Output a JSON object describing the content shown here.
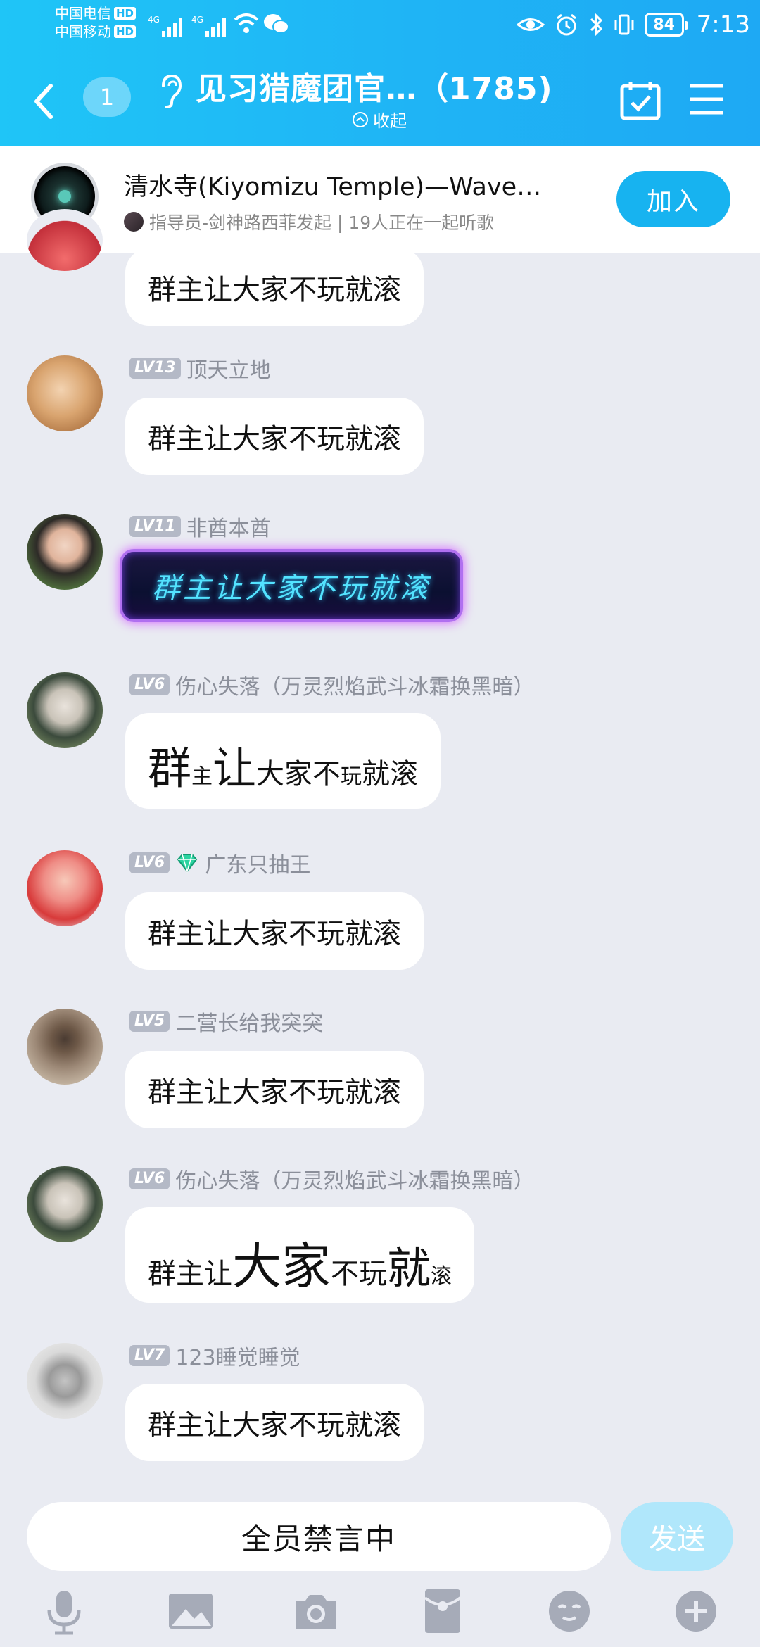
{
  "status_bar": {
    "carrier_1": "中国电信",
    "carrier_2": "中国移动",
    "hd": "HD",
    "net": "4G",
    "battery": "84",
    "time": "7:13"
  },
  "header": {
    "unread_count": "1",
    "title": "见习猎魔团官…（1785)",
    "collapse_label": "收起"
  },
  "music_banner": {
    "song_title": "清水寺(Kiyomizu Temple)—Wave…",
    "subtitle": "指导员-剑神路西菲发起 | 19人正在一起听歌",
    "join_label": "加入"
  },
  "messages": [
    {
      "text": "群主让大家不玩就滚"
    },
    {
      "level": "LV13",
      "name": "顶天立地",
      "text": "群主让大家不玩就滚"
    },
    {
      "level": "LV11",
      "name": "非酋本酋",
      "text": "群主让大家不玩就滚"
    },
    {
      "level": "LV6",
      "name": "伤心失落（万灵烈焰武斗冰霜换黑暗）",
      "parts": [
        "群",
        "主",
        "让",
        "大家不",
        "玩",
        "就滚"
      ]
    },
    {
      "level": "LV6",
      "name": "广东只抽王",
      "text": "群主让大家不玩就滚"
    },
    {
      "level": "LV5",
      "name": "二营长给我突突",
      "text": "群主让大家不玩就滚"
    },
    {
      "level": "LV6",
      "name": "伤心失落（万灵烈焰武斗冰霜换黑暗）",
      "parts": [
        "群主让",
        "大家",
        "不玩",
        "就",
        "滚"
      ]
    },
    {
      "level": "LV7",
      "name": "123睡觉睡觉",
      "text": "群主让大家不玩就滚"
    }
  ],
  "input_bar": {
    "placeholder": "全员禁言中",
    "send_label": "发送"
  },
  "toolbar_icons": [
    "microphone-icon",
    "image-icon",
    "camera-icon",
    "red-packet-icon",
    "emoji-icon",
    "plus-icon"
  ]
}
